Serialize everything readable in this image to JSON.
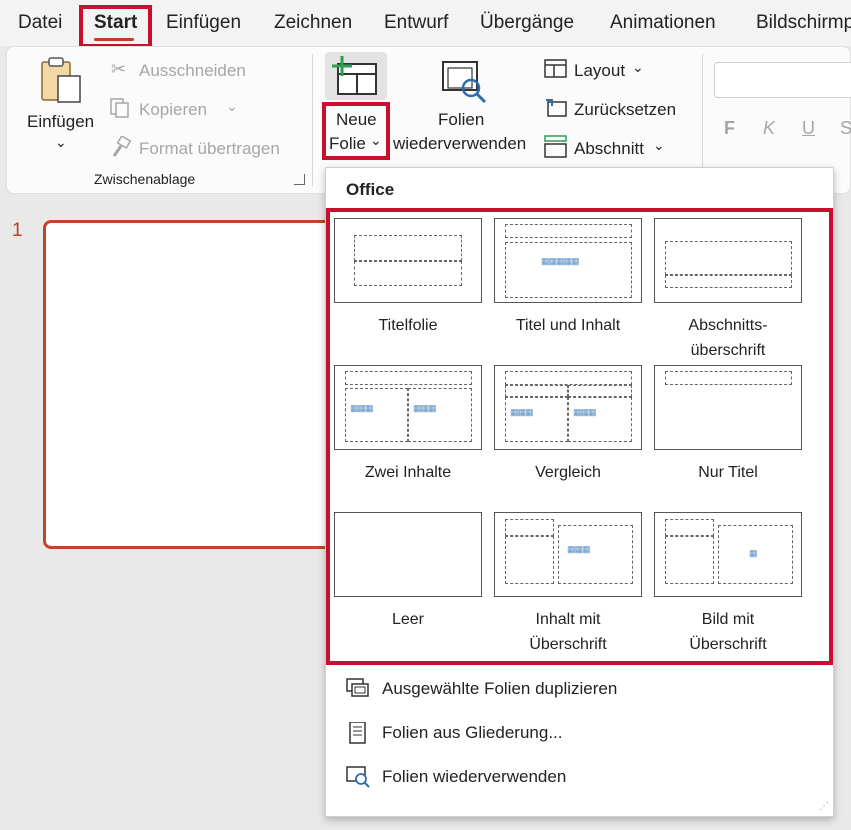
{
  "tabs": [
    "Datei",
    "Start",
    "Einfügen",
    "Zeichnen",
    "Entwurf",
    "Übergänge",
    "Animationen",
    "Bildschirmp"
  ],
  "active_tab": "Start",
  "clipboard": {
    "paste": "Einfügen",
    "cut": "Ausschneiden",
    "copy": "Kopieren",
    "format_painter": "Format übertragen",
    "group_label": "Zwischenablage"
  },
  "slides_group": {
    "new_slide_line1": "Neue",
    "new_slide_line2": "Folie",
    "reuse_line1": "Folien",
    "reuse_line2": "wiederverwenden",
    "layout": "Layout",
    "reset": "Zurücksetzen",
    "section": "Abschnitt"
  },
  "font_buttons": [
    "F",
    "K",
    "U",
    "S"
  ],
  "slide_number": "1",
  "dropdown": {
    "title": "Office",
    "layouts": [
      {
        "label": "Titelfolie"
      },
      {
        "label": "Titel und Inhalt"
      },
      {
        "label": "Abschnitts-\nüberschrift"
      },
      {
        "label": "Zwei Inhalte"
      },
      {
        "label": "Vergleich"
      },
      {
        "label": "Nur Titel"
      },
      {
        "label": "Leer"
      },
      {
        "label": "Inhalt mit\nÜberschrift"
      },
      {
        "label": "Bild mit\nÜberschrift"
      }
    ],
    "commands": [
      {
        "label": "Ausgewählte Folien duplizieren",
        "icon": "duplicate-slides-icon"
      },
      {
        "label": "Folien aus Gliederung...",
        "icon": "outline-icon"
      },
      {
        "label": "Folien wiederverwenden",
        "icon": "reuse-slides-icon"
      }
    ]
  },
  "colors": {
    "highlight": "#c8102e",
    "accent": "#c43e1c"
  }
}
